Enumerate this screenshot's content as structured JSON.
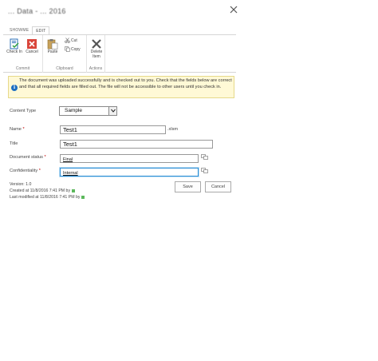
{
  "window": {
    "title": "... Data - ... 2016"
  },
  "ribbon": {
    "tabs": [
      {
        "label": "SHOWME"
      },
      {
        "label": "EDIT"
      }
    ],
    "commit": {
      "label": "Commit",
      "check_in": "Check In",
      "cancel": "Cancel"
    },
    "clipboard": {
      "label": "Clipboard",
      "paste": "Paste",
      "cut": "Cut",
      "copy": "Copy"
    },
    "actions": {
      "label": "Actions",
      "delete_item": "Delete Item"
    }
  },
  "notice": {
    "icon": "info-icon",
    "text": "The document was uploaded successfully and is checked out to you. Check that the fields below are correct and that all required fields are filled out. The file will not be accessible to other users until you check in."
  },
  "form": {
    "content_type": {
      "label": "Content Type",
      "value": "Sample"
    },
    "name": {
      "label": "Name",
      "required": "*",
      "value": "Test1",
      "extension": ".xlsm"
    },
    "title": {
      "label": "Title",
      "value": "Test1"
    },
    "document_status": {
      "label": "Document status",
      "required": "*",
      "value": "Final"
    },
    "confidentiality": {
      "label": "Confidentiality",
      "required": "*",
      "value": "Internal"
    }
  },
  "meta": {
    "version": "Version: 1.0",
    "created": "Created at 11/8/2016 7:41 PM  by",
    "modified": "Last modified at 11/8/2016 7:41 PM  by"
  },
  "buttons": {
    "save": "Save",
    "cancel": "Cancel"
  },
  "colors": {
    "info_bg": "#fff9d6",
    "info_icon": "#1e6fc1",
    "focus_border": "#2a8dd4",
    "required": "#bf0000",
    "presence": "#5cb85c"
  }
}
